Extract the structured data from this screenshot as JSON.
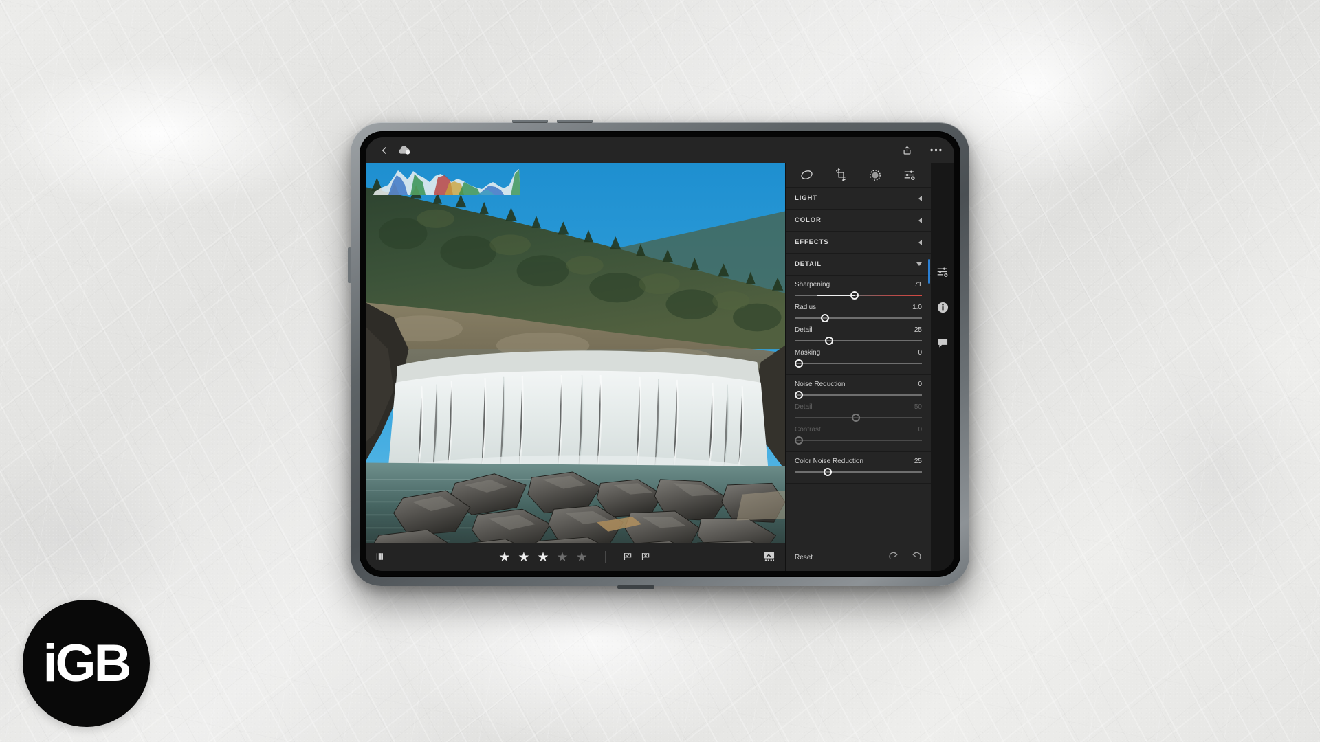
{
  "app": {
    "topbar": {
      "back_icon": "chevron-left-icon",
      "cloud_icon": "cloud-sync-icon",
      "share_icon": "share-upload-icon",
      "more_icon": "more-ellipsis-icon"
    },
    "panel_tools": [
      {
        "name": "presets-icon",
        "glyph": "◖"
      },
      {
        "name": "crop-rotate-icon",
        "glyph": "⟲"
      },
      {
        "name": "healing-brush-icon",
        "glyph": "◌"
      },
      {
        "name": "profile-adjust-icon",
        "glyph": "⇵"
      }
    ],
    "sections": [
      {
        "label": "LIGHT",
        "expanded": false
      },
      {
        "label": "COLOR",
        "expanded": false
      },
      {
        "label": "EFFECTS",
        "expanded": false
      },
      {
        "label": "DETAIL",
        "expanded": true
      }
    ],
    "detail_groups": [
      {
        "sliders": [
          {
            "label": "Sharpening",
            "value": "71",
            "pos": 47,
            "fill": "red",
            "dim": false
          },
          {
            "label": "Radius",
            "value": "1.0",
            "pos": 24,
            "fill": "none",
            "dim": false
          },
          {
            "label": "Detail",
            "value": "25",
            "pos": 27,
            "fill": "none",
            "dim": false
          },
          {
            "label": "Masking",
            "value": "0",
            "pos": 2,
            "fill": "none",
            "dim": false
          }
        ]
      },
      {
        "sliders": [
          {
            "label": "Noise Reduction",
            "value": "0",
            "pos": 2,
            "fill": "none",
            "dim": false
          },
          {
            "label": "Detail",
            "value": "50",
            "pos": 48,
            "fill": "none",
            "dim": true
          },
          {
            "label": "Contrast",
            "value": "0",
            "pos": 2,
            "fill": "none",
            "dim": true
          }
        ]
      },
      {
        "sliders": [
          {
            "label": "Color Noise Reduction",
            "value": "25",
            "pos": 26,
            "fill": "none",
            "dim": false
          }
        ]
      }
    ],
    "filmstrip": {
      "compare_icon": "before-after-compare-icon",
      "stars_filled": 3,
      "stars_total": 5,
      "flag_pick_icon": "flag-pick-icon",
      "flag_reject_icon": "flag-reject-icon",
      "export_icon": "add-photo-icon"
    },
    "panel_footer": {
      "reset_label": "Reset",
      "redo_icon": "redo-arrow-icon",
      "undo_icon": "undo-arrow-icon"
    },
    "rail": [
      {
        "name": "edit-sliders-icon",
        "active": true
      },
      {
        "name": "info-icon",
        "active": false
      },
      {
        "name": "comment-icon",
        "active": false
      }
    ]
  },
  "watermark": {
    "text": "iGB"
  },
  "theme": {
    "panel_bg": "#252525",
    "app_bg": "#1d1d1d",
    "rail_bg": "#171717",
    "accent_blue": "#2a7fd4",
    "slider_red": "#d34a42",
    "text": "#cfcfcf",
    "text_dim": "#5e5e5e"
  }
}
